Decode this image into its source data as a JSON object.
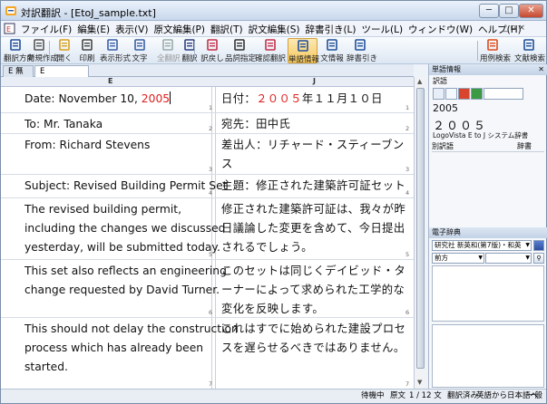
{
  "window": {
    "title": "対訳翻訳 - [EtoJ_sample.txt]",
    "min": "─",
    "max": "□",
    "close": "✕"
  },
  "menu": {
    "items": [
      "ファイル(F)",
      "編集(E)",
      "表示(V)",
      "原文編集(P)",
      "翻訳(T)",
      "訳文編集(S)",
      "辞書引き(L)",
      "ツール(L)",
      "ウィンドウ(W)",
      "ヘルプ(H)"
    ],
    "mdi_controls": "_ ▫ ×"
  },
  "toolbar": {
    "items": [
      {
        "label": "翻訳方向",
        "icon": "translation-direction-icon"
      },
      {
        "label": "新規作成",
        "icon": "new-document-icon"
      },
      {
        "label": "開く",
        "icon": "open-folder-icon"
      },
      {
        "label": "印刷",
        "icon": "print-icon"
      },
      {
        "label": "表示形式",
        "icon": "display-format-icon"
      },
      {
        "label": "文字",
        "icon": "font-icon"
      },
      {
        "label": "全翻訳",
        "icon": "translate-all-icon",
        "disabled": true
      },
      {
        "label": "翻訳",
        "icon": "translate-icon"
      },
      {
        "label": "訳戻し",
        "icon": "back-translate-icon"
      },
      {
        "label": "品詞指定",
        "icon": "part-of-speech-icon"
      },
      {
        "label": "確認翻訳",
        "icon": "confirm-translation-icon"
      },
      {
        "label": "単語情報",
        "icon": "word-info-icon",
        "active": true
      },
      {
        "label": "文情報",
        "icon": "sentence-info-icon"
      },
      {
        "label": "辞書引き",
        "icon": "dictionary-lookup-icon"
      },
      {
        "label": "用例検索",
        "icon": "example-search-icon"
      },
      {
        "label": "文献検索",
        "icon": "literature-search-icon"
      }
    ]
  },
  "tabs": [
    {
      "label": "E 無題1"
    },
    {
      "label": "E  EtoJ_sample.t"
    }
  ],
  "columns": {
    "source": "E",
    "target": "J"
  },
  "rows": [
    {
      "num": "1",
      "source": [
        "Date: November 10, "
      ],
      "source_red": "2005",
      "target": [
        "日付：",
        "２００５",
        "年１１月１０日"
      ]
    },
    {
      "num": "2",
      "source": [
        "To: Mr. Tanaka"
      ],
      "target": [
        "宛先：田中氏"
      ]
    },
    {
      "num": "3",
      "source": [
        "From: Richard Stevens"
      ],
      "target": [
        "差出人：リチャード・スティーブン",
        "ス"
      ]
    },
    {
      "num": "4",
      "source": [
        "Subject: Revised Building Permit Set"
      ],
      "target": [
        "主題：修正された建築許可証セット"
      ]
    },
    {
      "num": "5",
      "source": [
        "The revised building permit,",
        "including the changes we discussed",
        "yesterday, will be submitted today."
      ],
      "target": [
        "修正された建築許可証は、我々が昨",
        "日議論した変更を含めて、今日提出",
        "されるでしょう。"
      ]
    },
    {
      "num": "6",
      "source": [
        "This set also reflects an engineering",
        "change requested by David Turner."
      ],
      "target": [
        "このセットは同じくデイビッド・タ",
        "ーナーによって求められた工学的な",
        "変化を反映します。"
      ]
    },
    {
      "num": "7",
      "source": [
        "This should not delay the construction",
        "process which has already been",
        "started."
      ],
      "target": [
        "これはすでに始められた建設プロセ",
        "スを遅らせるべきではありません。"
      ]
    }
  ],
  "word_panel": {
    "title": "単語情報",
    "subtitle": "訳語",
    "source_word": "2005",
    "translation": "２００５",
    "dictionary": "LogoVista E to J システム辞書",
    "col_left": "別訳語",
    "col_right": "辞書"
  },
  "dict_panel": {
    "title": "電子辞典",
    "dictionary_select": "研究社 新英和(第7版)・和英",
    "search_mode": "前方",
    "search_value": ""
  },
  "status": {
    "state": "待機中",
    "mode": "原文",
    "position": "1 / 12 文",
    "translated": "翻訳済み",
    "direction": "英語から日本語へ",
    "category": "一般"
  }
}
